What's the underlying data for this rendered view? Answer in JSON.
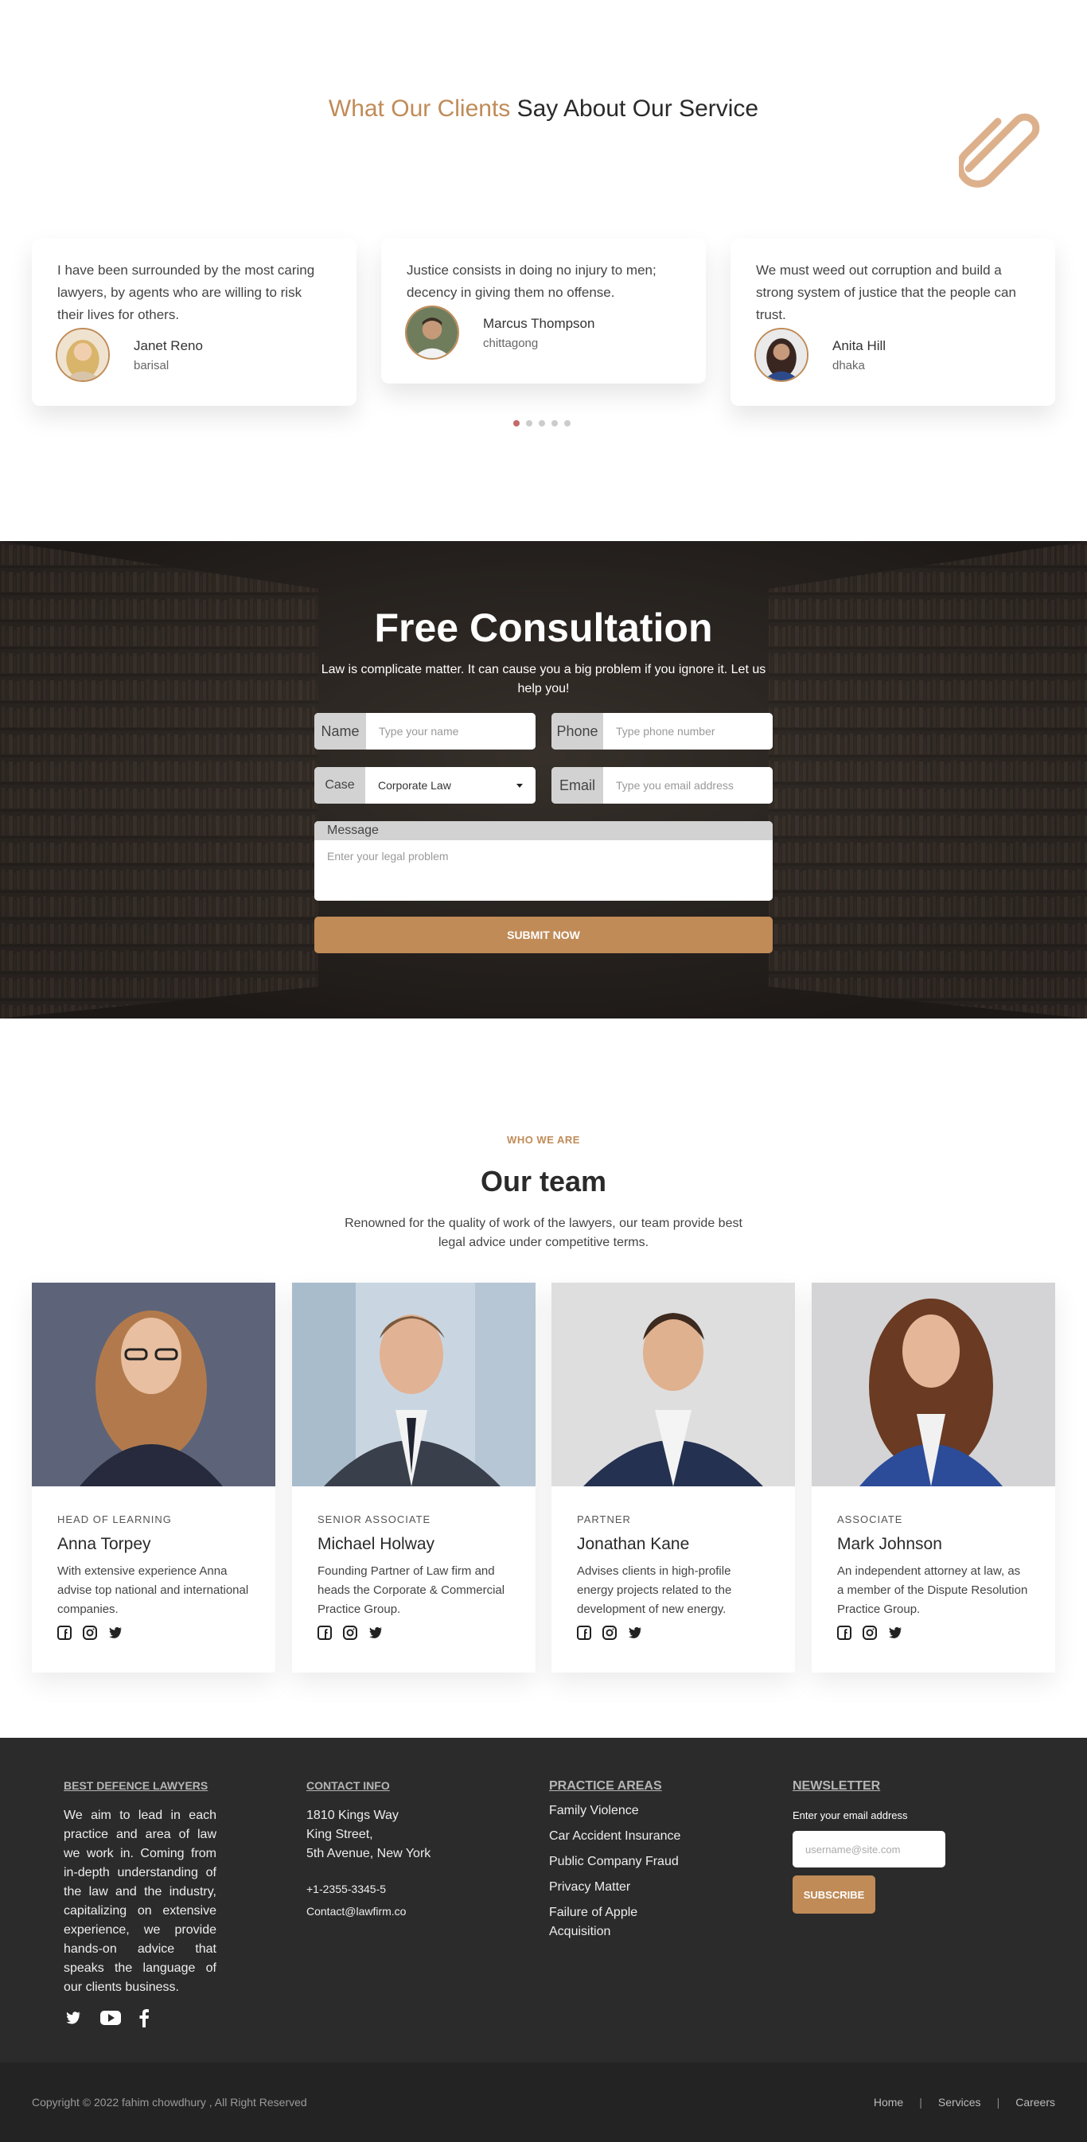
{
  "testimonials": {
    "heading_accent": "What Our Clients",
    "heading_rest": " Say About Our Service",
    "items": [
      {
        "quote": "I have been surrounded by the most caring lawyers, by agents who are willing to risk their lives for others.",
        "name": "Janet Reno",
        "location": "barisal"
      },
      {
        "quote": "Justice consists in doing no injury to men; decency in giving them no offense.",
        "name": "Marcus Thompson",
        "location": "chittagong"
      },
      {
        "quote": "We must weed out corruption and build a strong system of justice that the people can trust.",
        "name": "Anita Hill",
        "location": "dhaka"
      }
    ],
    "dot_count": 5,
    "active_dot": 0
  },
  "consultation": {
    "title": "Free Consultation",
    "subtitle": "Law is complicate matter. It can cause you a big problem if you ignore it. Let us help you!",
    "name_label": "Name",
    "name_placeholder": "Type your name",
    "phone_label": "Phone",
    "phone_placeholder": "Type phone number",
    "case_label": "Case",
    "case_value": "Corporate Law",
    "email_label": "Email",
    "email_placeholder": "Type you email address",
    "message_label": "Message",
    "message_placeholder": "Enter your legal problem",
    "submit_label": "SUBMIT NOW"
  },
  "team": {
    "eyebrow": "WHO WE ARE",
    "title": "Our team",
    "description": "Renowned for the quality of work of the lawyers, our team provide best legal advice under competitive terms.",
    "members": [
      {
        "role": "HEAD OF LEARNING",
        "name": "Anna Torpey",
        "bio": "With extensive experience Anna advise top national and international companies."
      },
      {
        "role": "SENIOR ASSOCIATE",
        "name": "Michael Holway",
        "bio": "Founding Partner of Law firm and heads the Corporate & Commercial Practice Group."
      },
      {
        "role": "PARTNER",
        "name": "Jonathan Kane",
        "bio": "Advises clients in high-profile energy projects related to the development of new energy."
      },
      {
        "role": "ASSOCIATE",
        "name": "Mark Johnson",
        "bio": "An independent attorney at law, as a member of the Dispute Resolution Practice Group."
      }
    ]
  },
  "footer": {
    "about_heading": "BEST DEFENCE LAWYERS",
    "about_text": "We aim to lead in each practice and area of law we work in. Coming from in-depth understanding of the law and the industry, capitalizing on extensive experience, we provide hands-on advice that speaks the language of our clients business.",
    "contact_heading": "CONTACT INFO",
    "address1": "1810 Kings Way",
    "address2": "King Street,",
    "address3": "5th Avenue, New York",
    "phone": "+1-2355-3345-5",
    "email": "Contact@lawfirm.co",
    "practice_heading": "PRACTICE AREAS",
    "practice_items": [
      "Family Violence",
      "Car Accident Insurance",
      "Public Company Fraud",
      "Privacy Matter",
      "Failure of Apple Acquisition"
    ],
    "newsletter_heading": "NEWSLETTER",
    "newsletter_label": "Enter your email address",
    "newsletter_placeholder": "username@site.com",
    "subscribe_label": "SUBSCRIBE",
    "copyright": "Copyright © 2022 fahim chowdhury , All Right Reserved",
    "nav": [
      "Home",
      "Services",
      "Careers"
    ]
  },
  "colors": {
    "accent": "#c08b57",
    "dark_bg": "#2b2b2b",
    "footer_bottom": "#232323"
  }
}
